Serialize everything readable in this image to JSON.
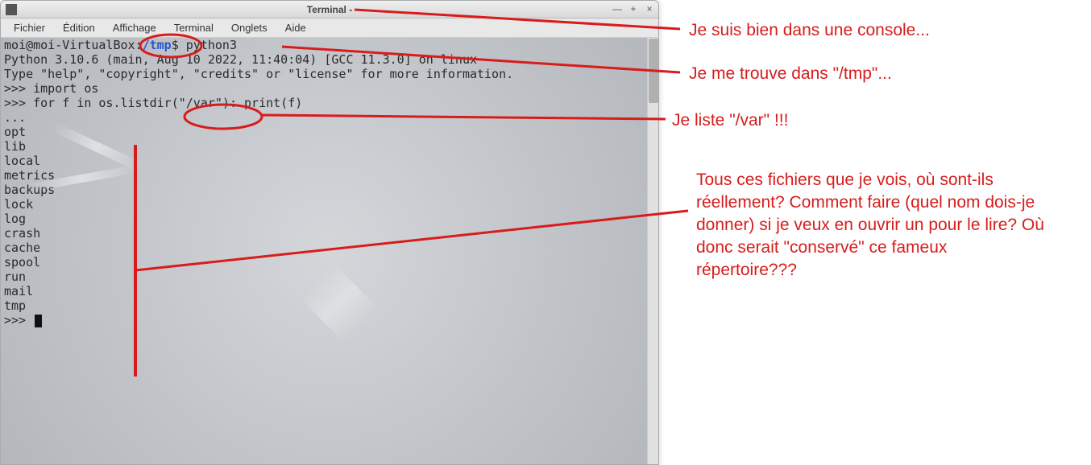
{
  "window": {
    "title": "Terminal -",
    "controls": {
      "min": "—",
      "max": "+",
      "close": "×"
    }
  },
  "menubar": {
    "items": [
      "Fichier",
      "Édition",
      "Affichage",
      "Terminal",
      "Onglets",
      "Aide"
    ]
  },
  "terminal": {
    "prompt_user": "moi@moi-VirtualBox",
    "prompt_sep": ":",
    "prompt_path": "/tmp",
    "prompt_sym": "$",
    "command": "python3",
    "lines": [
      "Python 3.10.6 (main, Aug 10 2022, 11:40:04) [GCC 11.3.0] on linux",
      "Type \"help\", \"copyright\", \"credits\" or \"license\" for more information.",
      ">>> import os",
      ">>> for f in os.listdir(\"/var\"): print(f)",
      "...",
      "opt",
      "lib",
      "local",
      "metrics",
      "backups",
      "lock",
      "log",
      "crash",
      "cache",
      "spool",
      "run",
      "mail",
      "tmp",
      ">>> "
    ]
  },
  "annotations": {
    "a1": "Je suis bien dans une console...",
    "a2": "Je me trouve dans \"/tmp\"...",
    "a3": "Je liste \"/var\" !!!",
    "a4": "Tous ces fichiers que je vois, où sont-ils réellement? Comment faire (quel nom dois-je donner) si je veux en ouvrir un pour le lire? Où donc serait \"conservé\" ce fameux répertoire???"
  },
  "colors": {
    "annotation_red": "#d81c1c",
    "path_blue": "#2456d6"
  }
}
